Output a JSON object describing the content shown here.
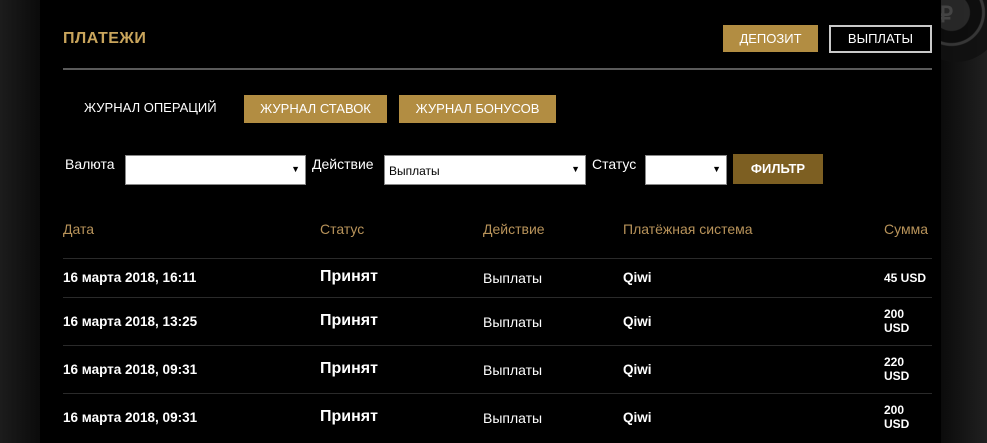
{
  "header": {
    "title": "ПЛАТЕЖИ",
    "deposit_label": "ДЕПОЗИТ",
    "payouts_label": "ВЫПЛАТЫ"
  },
  "tabs": {
    "operations": "ЖУРНАЛ ОПЕРАЦИЙ",
    "bets": "ЖУРНАЛ СТАВОК",
    "bonuses": "ЖУРНАЛ БОНУСОВ"
  },
  "filters": {
    "currency_label": "Валюта",
    "currency_value": "",
    "action_label": "Действие",
    "action_value": "Выплаты",
    "status_label": "Статус",
    "status_value": "",
    "filter_button": "ФИЛЬТР"
  },
  "table": {
    "columns": {
      "date": "Дата",
      "status": "Статус",
      "action": "Действие",
      "system": "Платёжная система",
      "amount": "Сумма"
    },
    "rows": [
      {
        "date": "16 марта 2018, 16:11",
        "status": "Принят",
        "action": "Выплаты",
        "system": "Qiwi",
        "amount_value": "45 USD",
        "amount_unit": ""
      },
      {
        "date": "16 марта 2018, 13:25",
        "status": "Принят",
        "action": "Выплаты",
        "system": "Qiwi",
        "amount_value": "200",
        "amount_unit": "USD"
      },
      {
        "date": "16 марта 2018, 09:31",
        "status": "Принят",
        "action": "Выплаты",
        "system": "Qiwi",
        "amount_value": "220",
        "amount_unit": "USD"
      },
      {
        "date": "16 марта 2018, 09:31",
        "status": "Принят",
        "action": "Выплаты",
        "system": "Qiwi",
        "amount_value": "200",
        "amount_unit": "USD"
      }
    ]
  },
  "colors": {
    "accent_gold": "#b28d42",
    "title_gold": "#c9a55c",
    "header_text": "#b8935a",
    "background": "#000000"
  }
}
